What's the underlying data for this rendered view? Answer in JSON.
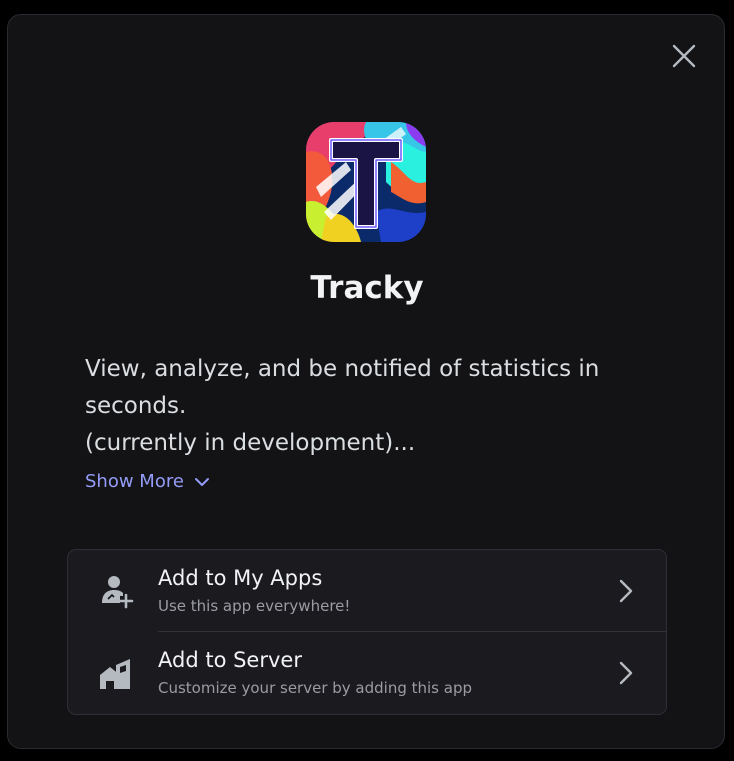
{
  "app": {
    "name": "Tracky",
    "description": "View, analyze, and be notified of statistics in seconds.\n(currently in development)...",
    "show_more_label": "Show More",
    "icon_letter": "T"
  },
  "actions": [
    {
      "title": "Add to My Apps",
      "subtitle": "Use this app everywhere!",
      "icon": "user-add-icon"
    },
    {
      "title": "Add to Server",
      "subtitle": "Customize your server by adding this app",
      "icon": "server-add-icon"
    }
  ],
  "colors": {
    "background": "#131316",
    "link": "#949cf7",
    "text_primary": "#f2f3f5",
    "text_secondary": "#9b9ca3"
  }
}
